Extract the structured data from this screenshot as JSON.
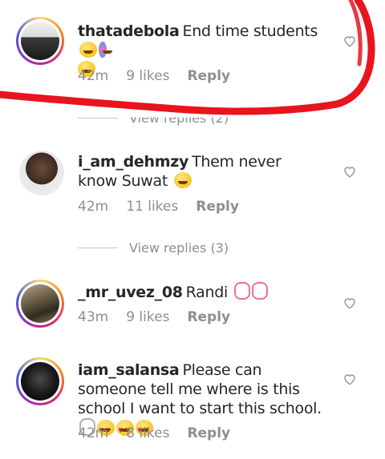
{
  "comments": [
    {
      "username": "thatadebola",
      "text": "End time students",
      "time": "42m",
      "likes": "9 likes",
      "reply": "Reply",
      "avatar_icon": "profile-photo"
    },
    {
      "username": "i_am_dehmzy",
      "text": "Them never know Suwat",
      "time": "42m",
      "likes": "11 likes",
      "reply": "Reply",
      "avatar_icon": "profile-photo"
    },
    {
      "username": "_mr_uvez_08",
      "text": "Randi",
      "time": "43m",
      "likes": "9 likes",
      "reply": "Reply",
      "avatar_icon": "profile-photo"
    },
    {
      "username": "iam_salansa",
      "text": "Please can someone tell me where is this school I want to start this school.",
      "time": "42m",
      "likes": "8 likes",
      "reply": "Reply",
      "avatar_icon": "profile-photo"
    }
  ],
  "view_replies": [
    {
      "label": "View replies (2)"
    },
    {
      "label": "View replies (3)"
    }
  ],
  "colors": {
    "text": "#262626",
    "meta": "#8e8e8e",
    "annotation": "#e8141e"
  },
  "icons": {
    "like": "heart-outline-icon"
  }
}
